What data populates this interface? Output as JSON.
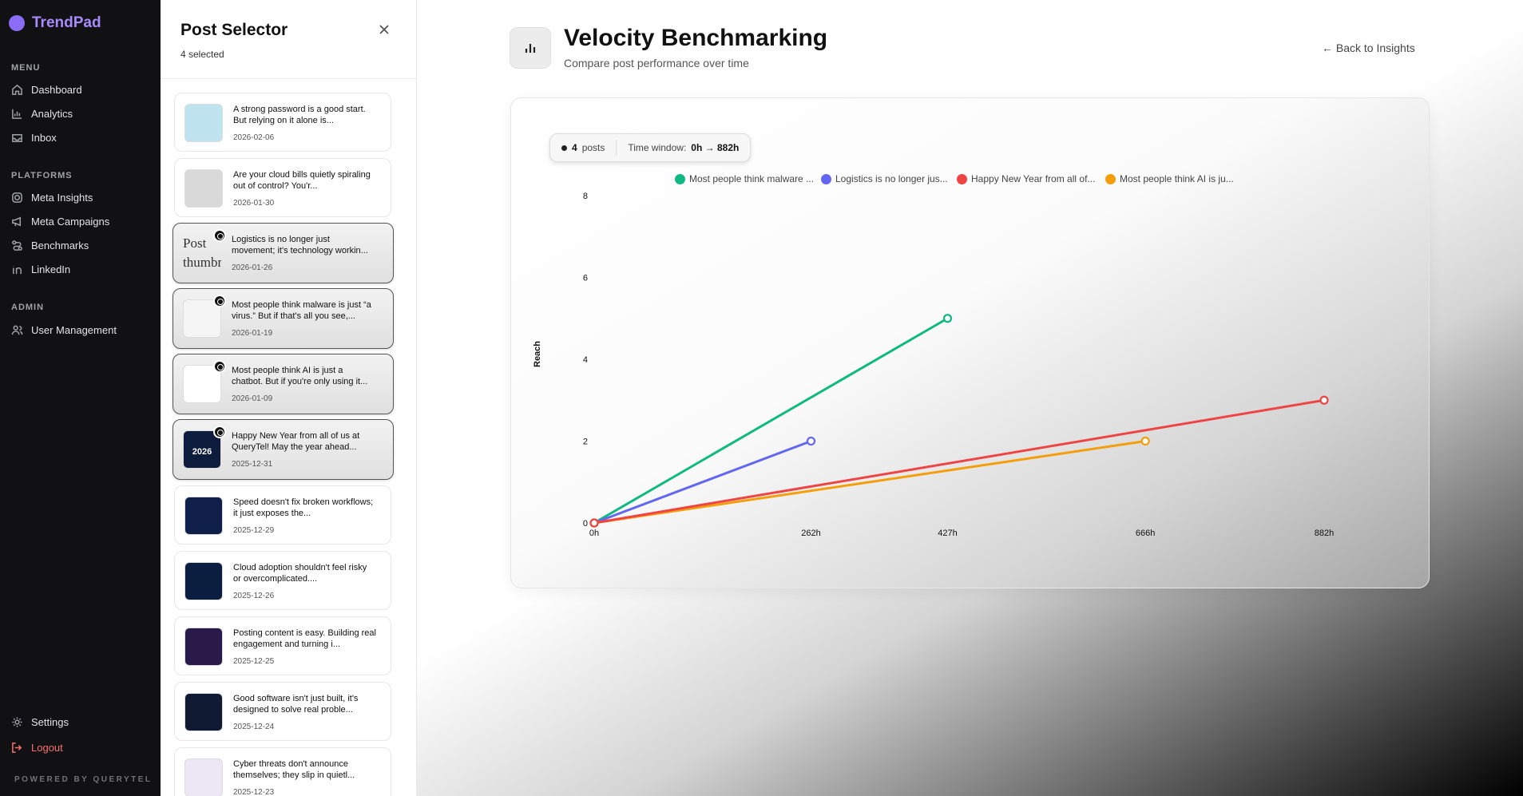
{
  "app": {
    "name": "TrendPad",
    "powered_by": "POWERED BY QUERYTEL"
  },
  "sidebar": {
    "menu_title": "MENU",
    "platforms_title": "PLATFORMS",
    "admin_title": "ADMIN",
    "menu_items": [
      {
        "label": "Dashboard",
        "icon": "home-icon"
      },
      {
        "label": "Analytics",
        "icon": "bar-chart-icon"
      },
      {
        "label": "Inbox",
        "icon": "inbox-icon"
      }
    ],
    "platform_items": [
      {
        "label": "Meta Insights",
        "icon": "instagram-icon"
      },
      {
        "label": "Meta Campaigns",
        "icon": "megaphone-icon"
      },
      {
        "label": "Benchmarks",
        "icon": "route-icon"
      },
      {
        "label": "LinkedIn",
        "icon": "linkedin-icon"
      }
    ],
    "admin_items": [
      {
        "label": "User Management",
        "icon": "users-icon"
      }
    ],
    "settings_label": "Settings",
    "logout_label": "Logout"
  },
  "selector": {
    "title": "Post Selector",
    "selected_count": "4 selected",
    "posts": [
      {
        "text": "A strong password is a good start. But relying on it alone is...",
        "date": "2026-02-06",
        "selected": false,
        "thumb": "#bfe3ef"
      },
      {
        "text": "Are your cloud bills quietly spiraling out of control? You'r...",
        "date": "2026-01-30",
        "selected": false,
        "thumb": "#d9d9d9"
      },
      {
        "text": "Logistics is no longer just movement; it's technology workin...",
        "date": "2026-01-26",
        "selected": true,
        "thumb": "broken",
        "thumb_alt": "Post thumbnail"
      },
      {
        "text": "Most people think malware is just “a virus.” But if that's all you see,...",
        "date": "2026-01-19",
        "selected": true,
        "thumb": "#f5f5f5"
      },
      {
        "text": "Most people think AI is just a chatbot. But if you're only using it...",
        "date": "2026-01-09",
        "selected": true,
        "thumb": "#ffffff"
      },
      {
        "text": "Happy New Year from all of us at QueryTel! May the year ahead...",
        "date": "2025-12-31",
        "selected": true,
        "thumb": "#0d1b3d",
        "thumb_text": "2026"
      },
      {
        "text": "Speed doesn't fix broken workflows; it just exposes the...",
        "date": "2025-12-29",
        "selected": false,
        "thumb": "#0f1f4a"
      },
      {
        "text": "Cloud adoption shouldn't feel risky or overcomplicated....",
        "date": "2025-12-26",
        "selected": false,
        "thumb": "#0b1e3f"
      },
      {
        "text": "Posting content is easy. Building real engagement and turning i...",
        "date": "2025-12-25",
        "selected": false,
        "thumb": "#2a1a4a"
      },
      {
        "text": "Good software isn't just built, it's designed to solve real proble...",
        "date": "2025-12-24",
        "selected": false,
        "thumb": "#111a33"
      },
      {
        "text": "Cyber threats don't announce themselves; they slip in quietl...",
        "date": "2025-12-23",
        "selected": false,
        "thumb": "#ece6f5"
      }
    ]
  },
  "main": {
    "title": "Velocity Benchmarking",
    "subtitle": "Compare post performance over time",
    "back_label": "← Back to Insights",
    "pill": {
      "count": "4",
      "count_label": "posts",
      "window_label": "Time window:",
      "window_value": "0h → 882h"
    }
  },
  "chart_data": {
    "type": "line",
    "ylabel": "Reach",
    "xlabel": "",
    "ylim": [
      0,
      8
    ],
    "yticks": [
      0,
      2,
      4,
      6,
      8
    ],
    "x_ticks": [
      "0h",
      "262h",
      "427h",
      "666h",
      "882h"
    ],
    "x_tick_values": [
      0,
      262,
      427,
      666,
      882
    ],
    "legend_position": "top",
    "series": [
      {
        "name": "Most people think malware ...",
        "color": "#10b981",
        "points": [
          [
            0,
            0
          ],
          [
            427,
            5
          ]
        ]
      },
      {
        "name": "Logistics is no longer jus...",
        "color": "#6366f1",
        "points": [
          [
            0,
            0
          ],
          [
            262,
            2
          ]
        ]
      },
      {
        "name": "Happy New Year from all of...",
        "color": "#ef4444",
        "points": [
          [
            0,
            0
          ],
          [
            882,
            3
          ]
        ]
      },
      {
        "name": "Most people think AI is ju...",
        "color": "#f59e0b",
        "points": [
          [
            0,
            0
          ],
          [
            666,
            2
          ]
        ]
      }
    ]
  }
}
